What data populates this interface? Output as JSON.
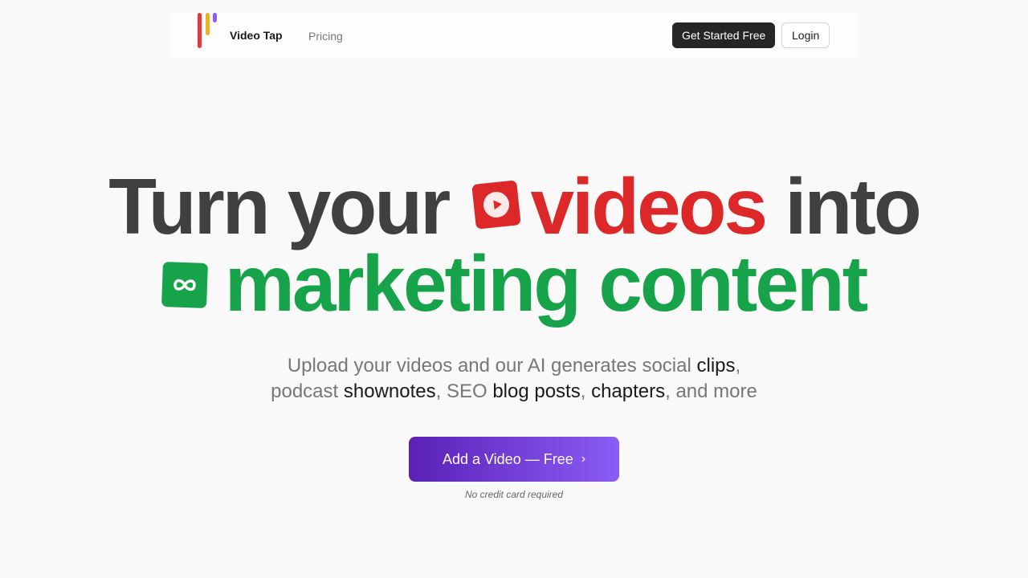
{
  "nav": {
    "brand": "Video Tap",
    "pricing_link": "Pricing",
    "get_started_button": "Get Started Free",
    "login_button": "Login"
  },
  "hero": {
    "line1_prefix": "Turn your",
    "line1_highlight": "videos",
    "line1_suffix": "into",
    "line2": "marketing content",
    "colors": {
      "text": "#404040",
      "red": "#dc2828",
      "green": "#17a34a"
    }
  },
  "subtitle": {
    "part1": "Upload your videos and our AI generates social ",
    "clips": "clips",
    "comma1": ",",
    "part2": "podcast ",
    "shownotes": "shownotes",
    "part3": ", SEO ",
    "blog_posts": "blog posts",
    "comma2": ", ",
    "chapters": "chapters",
    "part4": ", and more"
  },
  "cta": {
    "label": "Add a Video — Free",
    "chevron": "›",
    "gradient": [
      "#5b21b6",
      "#8b5cf6"
    ],
    "note": "No credit card required"
  }
}
